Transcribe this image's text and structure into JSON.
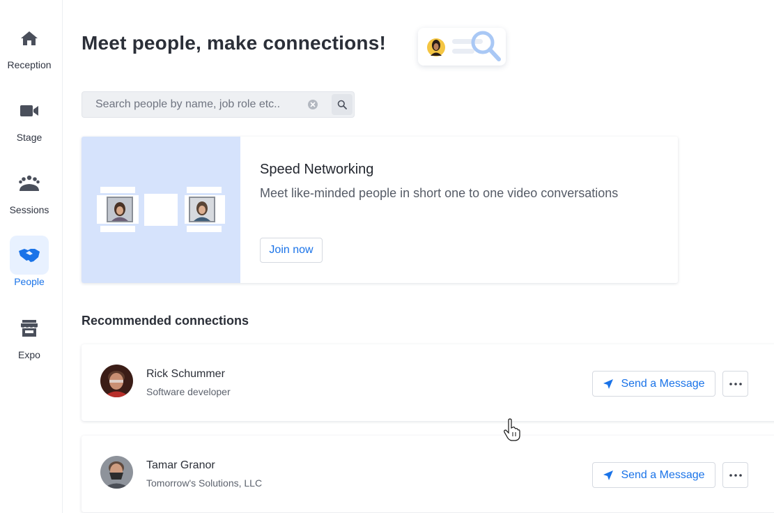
{
  "sidebar": {
    "items": [
      {
        "label": "Reception",
        "icon": "home-icon"
      },
      {
        "label": "Stage",
        "icon": "video-camera-icon"
      },
      {
        "label": "Sessions",
        "icon": "group-icon"
      },
      {
        "label": "People",
        "icon": "handshake-icon",
        "active": true
      },
      {
        "label": "Expo",
        "icon": "store-icon"
      }
    ]
  },
  "header": {
    "title": "Meet people, make connections!"
  },
  "search": {
    "placeholder": "Search people by name, job role etc..",
    "value": ""
  },
  "speed_networking": {
    "title": "Speed Networking",
    "description": "Meet like-minded people in short one to one video conversations",
    "button": "Join now"
  },
  "recommended": {
    "title": "Recommended connections",
    "people": [
      {
        "name": "Rick Schummer",
        "role": "Software developer",
        "action": "Send a Message"
      },
      {
        "name": "Tamar Granor",
        "role": "Tomorrow's Solutions, LLC",
        "action": "Send a Message"
      }
    ]
  },
  "colors": {
    "accent": "#1a73e8",
    "active_bg": "#e8f1ff",
    "illustration_bg": "#d6e3fc",
    "icon": "#4a4f5b"
  }
}
